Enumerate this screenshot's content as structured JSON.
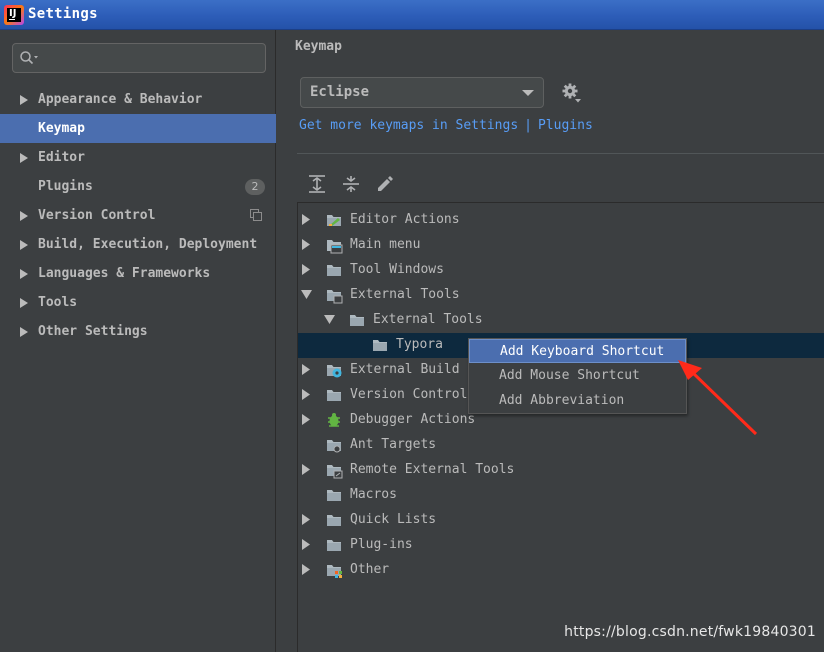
{
  "window": {
    "title": "Settings",
    "app_icon": "intellij-idea-icon"
  },
  "sidebar": {
    "search": {
      "value": "",
      "placeholder": ""
    },
    "items": [
      {
        "label": "Appearance & Behavior",
        "expandable": true,
        "selected": false
      },
      {
        "label": "Keymap",
        "expandable": false,
        "selected": true
      },
      {
        "label": "Editor",
        "expandable": true,
        "selected": false
      },
      {
        "label": "Plugins",
        "expandable": false,
        "selected": false,
        "badge": "2"
      },
      {
        "label": "Version Control",
        "expandable": true,
        "selected": false,
        "icon": "copy-icon"
      },
      {
        "label": "Build, Execution, Deployment",
        "expandable": true,
        "selected": false
      },
      {
        "label": "Languages & Frameworks",
        "expandable": true,
        "selected": false
      },
      {
        "label": "Tools",
        "expandable": true,
        "selected": false
      },
      {
        "label": "Other Settings",
        "expandable": true,
        "selected": false
      }
    ]
  },
  "main": {
    "title": "Keymap",
    "keymap_select": {
      "value": "Eclipse"
    },
    "links": {
      "get_more": "Get more keymaps in Settings",
      "separator": "|",
      "plugins": "Plugins"
    },
    "toolbar": [
      "expand-all-icon",
      "collapse-all-icon",
      "edit-icon"
    ],
    "tree": [
      {
        "label": "Editor Actions",
        "level": 0,
        "state": "collapsed",
        "icon": "editor-actions-icon"
      },
      {
        "label": "Main menu",
        "level": 0,
        "state": "collapsed",
        "icon": "main-menu-icon"
      },
      {
        "label": "Tool Windows",
        "level": 0,
        "state": "collapsed",
        "icon": "folder-icon"
      },
      {
        "label": "External Tools",
        "level": 0,
        "state": "expanded",
        "icon": "external-tools-icon"
      },
      {
        "label": "External Tools",
        "level": 1,
        "state": "expanded",
        "icon": "folder-icon"
      },
      {
        "label": "Typora",
        "level": 2,
        "state": "leaf",
        "icon": "folder-icon",
        "selected": true
      },
      {
        "label": "External Build",
        "level": 0,
        "state": "collapsed",
        "icon": "external-build-icon"
      },
      {
        "label": "Version Control",
        "level": 0,
        "state": "collapsed",
        "icon": "folder-icon"
      },
      {
        "label": "Debugger Actions",
        "level": 0,
        "state": "collapsed",
        "icon": "debugger-icon"
      },
      {
        "label": "Ant Targets",
        "level": 0,
        "state": "leaf",
        "icon": "ant-targets-icon"
      },
      {
        "label": "Remote External Tools",
        "level": 0,
        "state": "collapsed",
        "icon": "remote-tools-icon"
      },
      {
        "label": "Macros",
        "level": 0,
        "state": "leaf",
        "icon": "folder-icon"
      },
      {
        "label": "Quick Lists",
        "level": 0,
        "state": "collapsed",
        "icon": "folder-icon"
      },
      {
        "label": "Plug-ins",
        "level": 0,
        "state": "collapsed",
        "icon": "folder-icon"
      },
      {
        "label": "Other",
        "level": 0,
        "state": "collapsed",
        "icon": "other-icon"
      }
    ]
  },
  "context_menu": {
    "items": [
      {
        "label": "Add Keyboard Shortcut",
        "active": true
      },
      {
        "label": "Add Mouse Shortcut",
        "active": false
      },
      {
        "label": "Add Abbreviation",
        "active": false
      }
    ]
  },
  "annotation": {
    "arrow_color": "#ff2a1a"
  },
  "watermark": "https://blog.csdn.net/fwk19840301",
  "colors": {
    "accent": "#4b6eaf",
    "link": "#589df6",
    "background": "#3c3f41",
    "selection_dark": "#0d293e"
  }
}
